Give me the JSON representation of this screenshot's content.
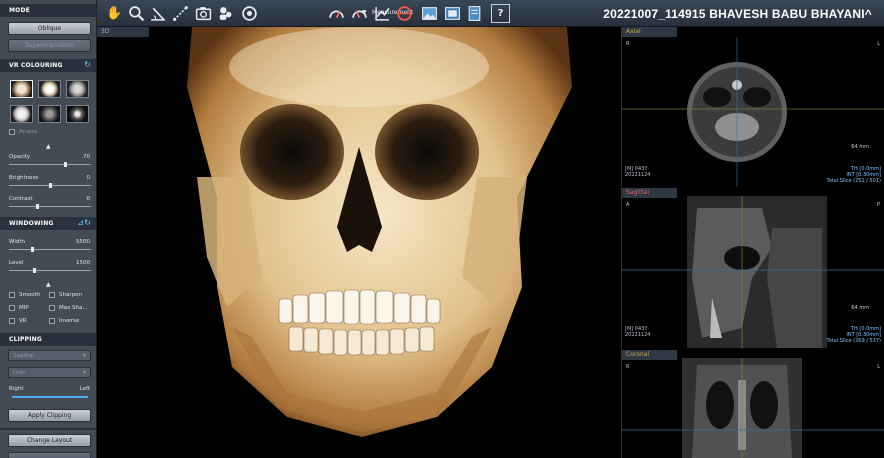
{
  "toolbar": {
    "measurement_label": "Measurement",
    "patient_title": "20221007_114915  BHAVESH BABU BHAYANI^"
  },
  "mode": {
    "header": "MODE",
    "oblique_label": "Oblique",
    "superimposition_label": "Superimposition"
  },
  "vr_colouring": {
    "header": "VR COLOURING",
    "airway_label": "Airway",
    "opacity_label": "Opacity",
    "opacity_value": "70",
    "opacity_level": 0.7,
    "brightness_label": "Brightness",
    "brightness_value": "0",
    "brightness_level": 0.5,
    "contrast_label": "Contrast",
    "contrast_value": "0",
    "contrast_level": 0.5
  },
  "windowing": {
    "header": "WINDOWING",
    "width_label": "Width",
    "width_value": "5500",
    "level_label": "Level",
    "level_value": "1500",
    "options": [
      "Smooth",
      "Sharpen",
      "MIP",
      "Max Sha...",
      "VR",
      "Inverse"
    ]
  },
  "clipping": {
    "header": "CLIPPING",
    "view_select": "Sagittal",
    "mode_select": "User",
    "right_label": "Right",
    "left_label": "Left",
    "apply_label": "Apply Clipping"
  },
  "layout": {
    "change_layout_label": "Change Layout"
  },
  "view3d": {
    "tab": "3D"
  },
  "slices": [
    {
      "tab": "Axial",
      "tab_color": "#c9a94a",
      "ori_left": "R",
      "ori_right": "L",
      "mm": "64 mm",
      "info_left": [
        "[M] 043Y",
        "20221124"
      ],
      "info_right": [
        "TH [0.0mm]",
        "INT [0.30mm]",
        "Total Slice (251 / 501)"
      ]
    },
    {
      "tab": "Sagittal",
      "tab_color": "#d06a6a",
      "ori_left": "A",
      "ori_right": "P",
      "mm": "64 mm",
      "info_left": [
        "[M] 043Y",
        "20221124"
      ],
      "info_right": [
        "TH [0.0mm]",
        "INT [0.30mm]",
        "Total Slice (269 / 537)"
      ]
    },
    {
      "tab": "Coronal",
      "tab_color": "#c9a94a",
      "ori_left": "R",
      "ori_right": "L"
    }
  ],
  "icons": [
    "hand-icon",
    "zoom-icon",
    "angle-icon",
    "line-measure-icon",
    "camera-icon",
    "people-icon",
    "capture-icon",
    "caret-down-icon",
    "gauge-icon",
    "gauge2-icon",
    "chart-icon",
    "circle-slash-icon",
    "image-icon",
    "image2-icon",
    "pages-icon",
    "help-icon",
    "refresh-icon"
  ]
}
